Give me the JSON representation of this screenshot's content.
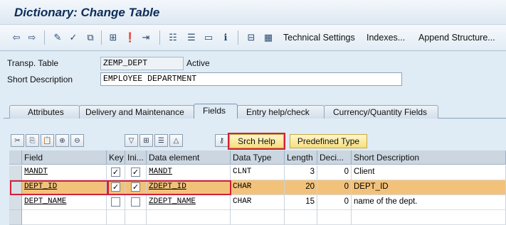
{
  "window": {
    "title": "Dictionary: Change Table"
  },
  "toolbar": {
    "icons": [
      "back-arrow-icon",
      "forward-arrow-icon",
      "pencil-glasses-icon",
      "activate-icon",
      "object-list-icon",
      "hierarchy-icon",
      "where-used-icon",
      "navigation-icon",
      "display-object-list-icon",
      "window-icon",
      "info-icon",
      "tree-icon",
      "table-grid-icon"
    ],
    "technical_settings": "Technical Settings",
    "indexes": "Indexes...",
    "append_structure": "Append Structure..."
  },
  "header": {
    "transp_table_label": "Transp. Table",
    "transp_table_value": "ZEMP_DEPT",
    "status": "Active",
    "short_desc_label": "Short Description",
    "short_desc_value": "EMPLOYEE DEPARTMENT"
  },
  "tabs": [
    {
      "label": "Attributes"
    },
    {
      "label": "Delivery and Maintenance"
    },
    {
      "label": "Fields"
    },
    {
      "label": "Entry help/check"
    },
    {
      "label": "Currency/Quantity Fields"
    }
  ],
  "active_tab": "Fields",
  "buttons": {
    "srch_help": "Srch Help",
    "predefined_type": "Predefined Type"
  },
  "grid": {
    "columns": [
      "Field",
      "Key",
      "Ini...",
      "Data element",
      "Data Type",
      "Length",
      "Deci...",
      "Short Description"
    ],
    "rows": [
      {
        "field": "MANDT",
        "key": true,
        "ini": true,
        "data_element": "MANDT",
        "data_type": "CLNT",
        "length": "3",
        "decimals": "0",
        "short_description": "Client"
      },
      {
        "field": "DEPT_ID",
        "key": true,
        "ini": true,
        "data_element": "ZDEPT_ID",
        "data_type": "CHAR",
        "length": "20",
        "decimals": "0",
        "short_description": "DEPT_ID"
      },
      {
        "field": "DEPT_NAME",
        "key": false,
        "ini": false,
        "data_element": "ZDEPT_NAME",
        "data_type": "CHAR",
        "length": "15",
        "decimals": "0",
        "short_description": "name of the dept."
      }
    ]
  },
  "colors": {
    "highlight_row": "#f3c27a",
    "annotation_red": "#d2213a",
    "title_blue": "#0d2c58"
  }
}
